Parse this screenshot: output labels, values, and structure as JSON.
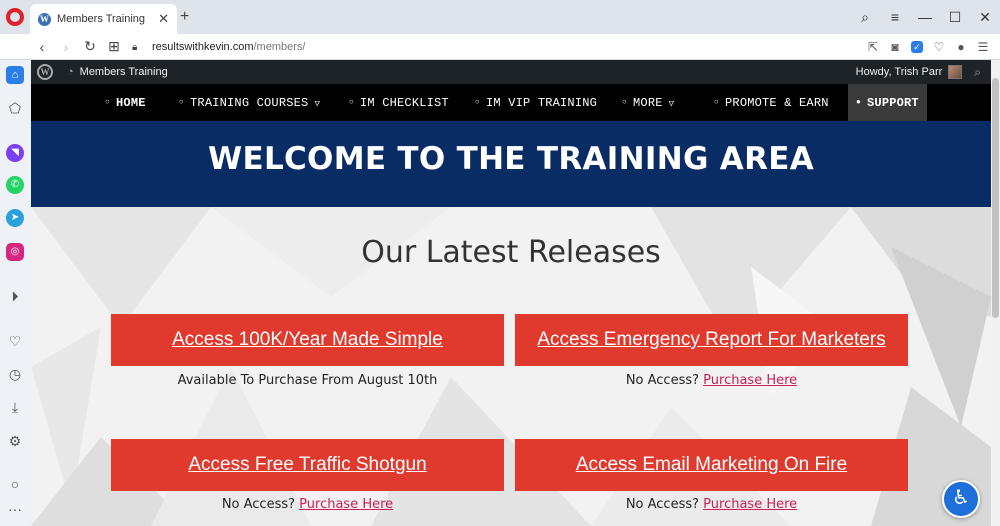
{
  "browser": {
    "tab_title": "Members Training",
    "url_domain": "resultswithkevin.com",
    "url_path": "/members/"
  },
  "admin_bar": {
    "site_name": "Members Training",
    "greeting": "Howdy, Trish Parr"
  },
  "nav": {
    "items": [
      {
        "label": "HOME"
      },
      {
        "label": "TRAINING COURSES"
      },
      {
        "label": "IM CHECKLIST"
      },
      {
        "label": "IM VIP TRAINING"
      },
      {
        "label": "MORE"
      },
      {
        "label": "PROMOTE & EARN"
      },
      {
        "label": "SUPPORT"
      }
    ]
  },
  "hero": {
    "title": "WELCOME TO THE TRAINING AREA"
  },
  "releases": {
    "heading": "Our Latest Releases",
    "cards": [
      {
        "button": "Access 100K/Year Made Simple",
        "note": "Available To Purchase From August 10th",
        "link": ""
      },
      {
        "button": "Access Emergency Report For Marketers",
        "note": "No Access?",
        "link": "Purchase Here"
      },
      {
        "button": "Access Free Traffic Shotgun",
        "note": "No Access?",
        "link": "Purchase Here"
      },
      {
        "button": "Access Email Marketing On Fire",
        "note": "No Access?",
        "link": "Purchase Here"
      }
    ]
  },
  "icons": {
    "back": "arrow-left-icon",
    "forward": "arrow-right-icon",
    "reload": "reload-icon",
    "accessibility": "accessibility-icon"
  },
  "colors": {
    "hero_bg": "#0a2c64",
    "button_red": "#e03a2f",
    "link_pink": "#c81e5a",
    "nav_bg": "#000000"
  }
}
